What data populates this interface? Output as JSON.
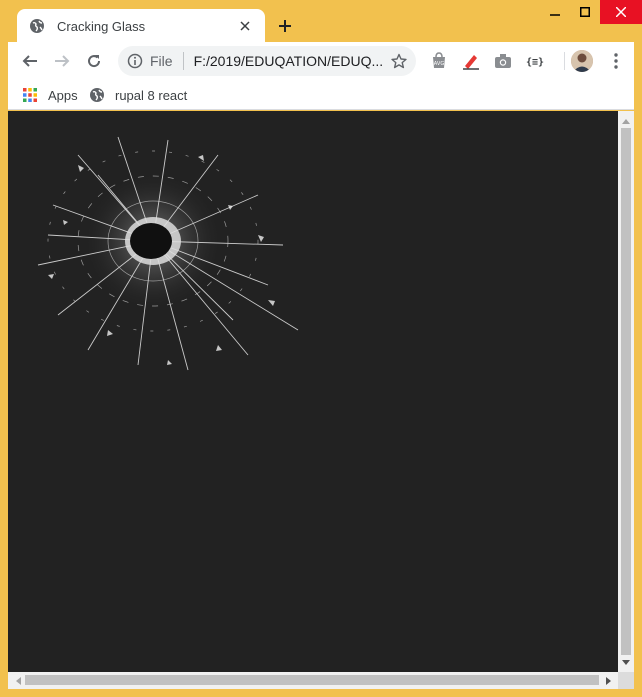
{
  "tab": {
    "title": "Cracking Glass",
    "favicon": "globe-icon"
  },
  "window_controls": [
    "minimize-icon",
    "maximize-icon",
    "close-icon"
  ],
  "omnibox": {
    "scheme": "File",
    "url": "F:/2019/EDUQATION/EDUQ..."
  },
  "extensions": [
    "avg-icon",
    "pen-icon",
    "camera-icon",
    "json-icon"
  ],
  "bookmarks": [
    {
      "label": "Apps",
      "icon": "apps-grid-icon"
    },
    {
      "label": "rupal 8 react",
      "icon": "globe-icon"
    }
  ],
  "page": {
    "background": "#222222",
    "content": "cracked-glass-image"
  },
  "colors": {
    "frame": "#f2c14e",
    "close_button": "#e81123"
  }
}
